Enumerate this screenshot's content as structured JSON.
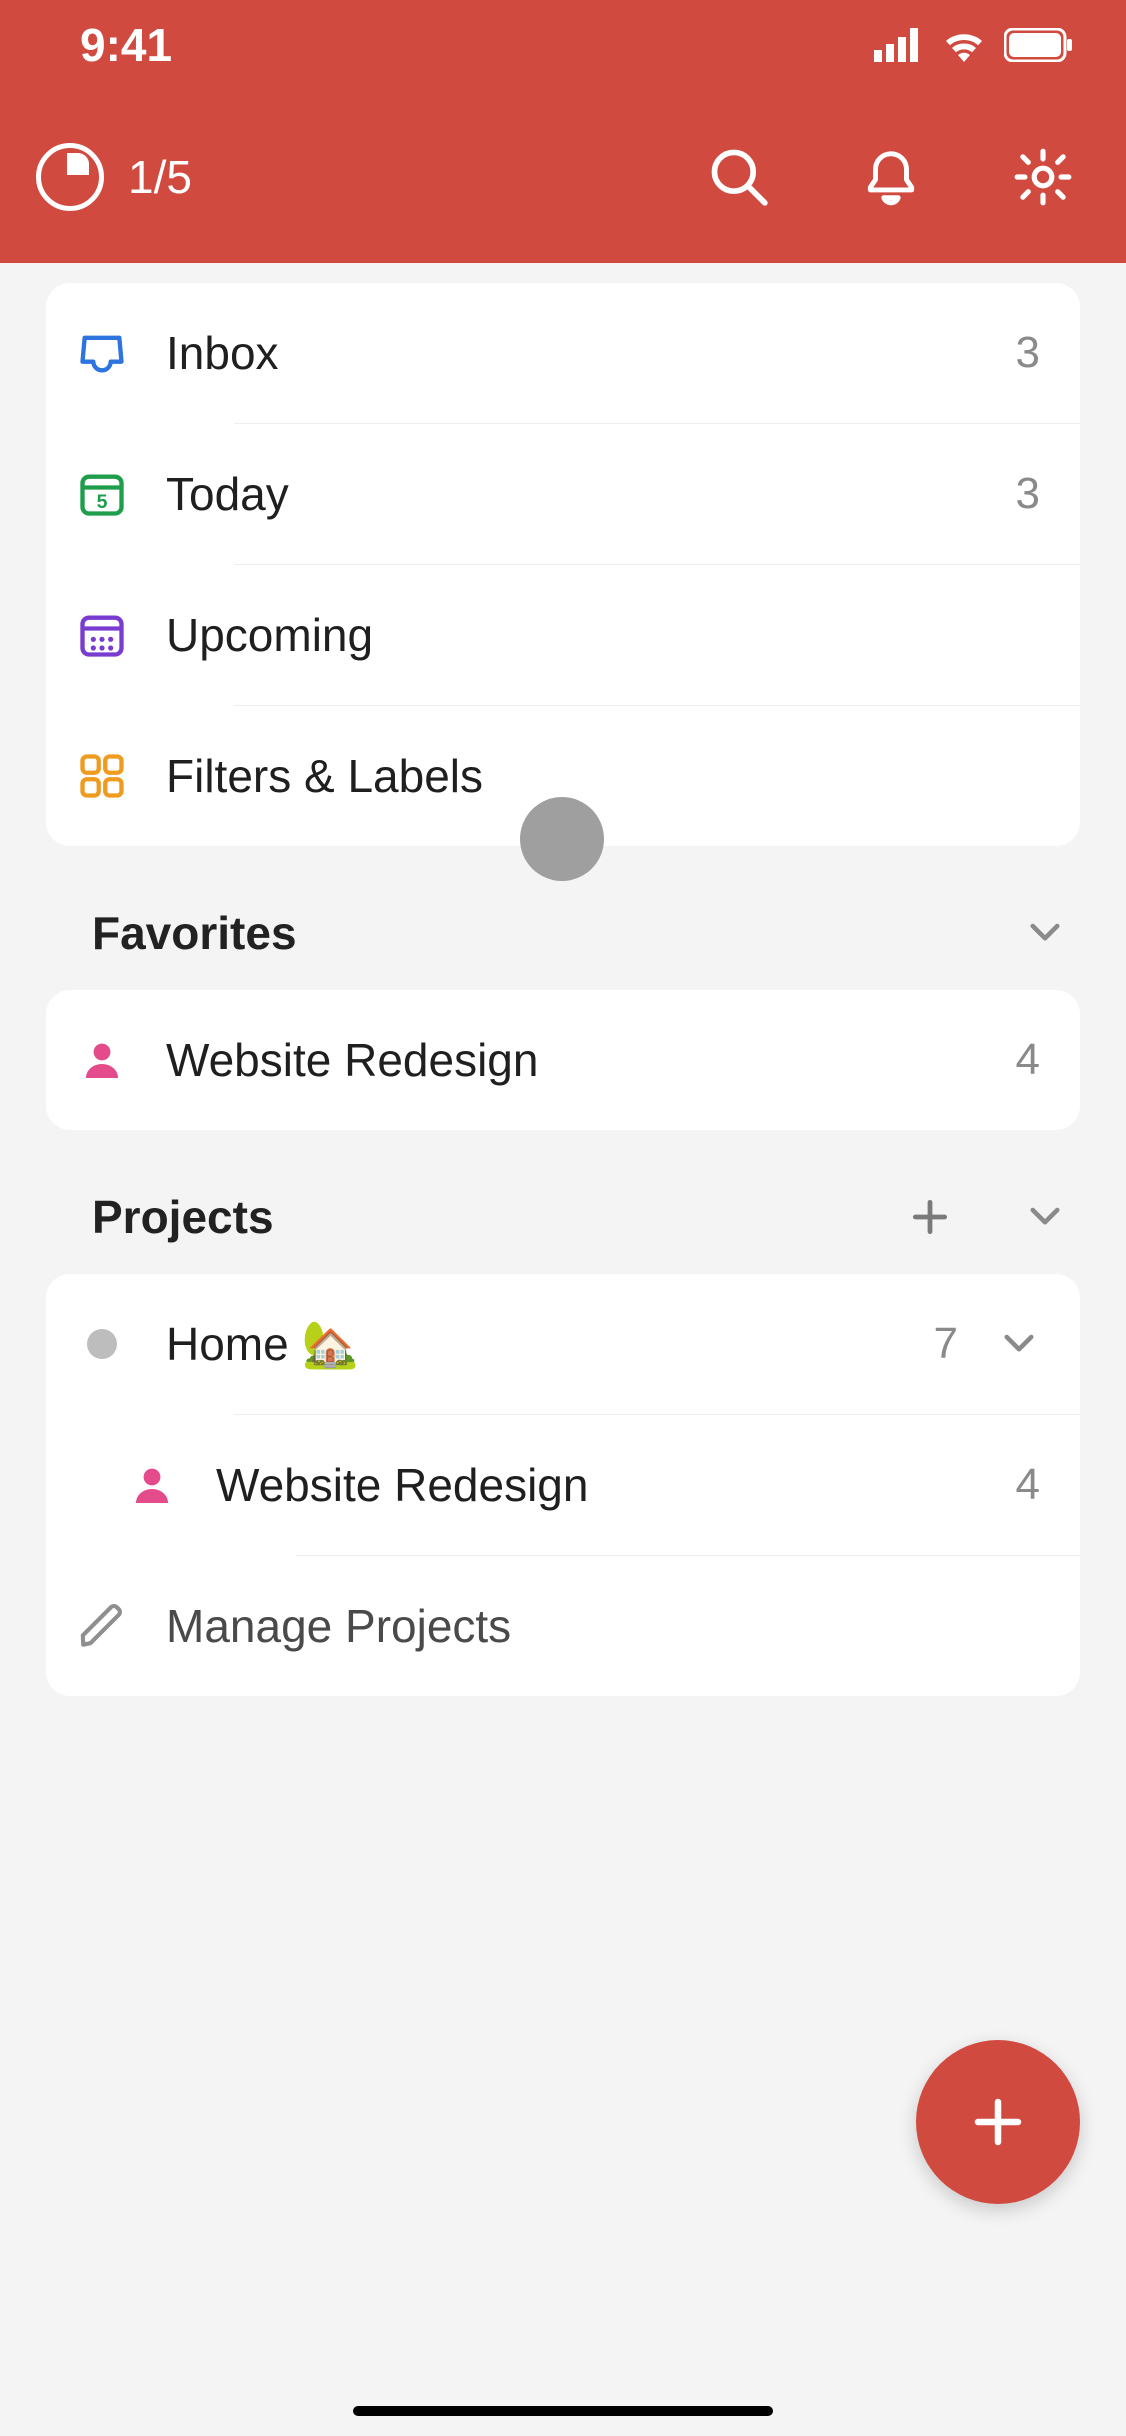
{
  "statusbar": {
    "time": "9:41"
  },
  "toolbar": {
    "progress": "1/5"
  },
  "views": [
    {
      "icon": "inbox",
      "label": "Inbox",
      "count": "3"
    },
    {
      "icon": "today",
      "label": "Today",
      "count": "3"
    },
    {
      "icon": "upcoming",
      "label": "Upcoming",
      "count": ""
    },
    {
      "icon": "grid",
      "label": "Filters & Labels",
      "count": ""
    }
  ],
  "sections": {
    "favorites": {
      "title": "Favorites",
      "items": [
        {
          "icon": "person",
          "color": "#e34b8a",
          "label": "Website Redesign",
          "count": "4"
        }
      ]
    },
    "projects": {
      "title": "Projects",
      "items": [
        {
          "icon": "dot",
          "label": "Home 🏡",
          "count": "7",
          "expandable": true
        },
        {
          "icon": "person",
          "indent": true,
          "color": "#e34b8a",
          "label": "Website Redesign",
          "count": "4"
        }
      ],
      "manage": "Manage Projects"
    }
  }
}
